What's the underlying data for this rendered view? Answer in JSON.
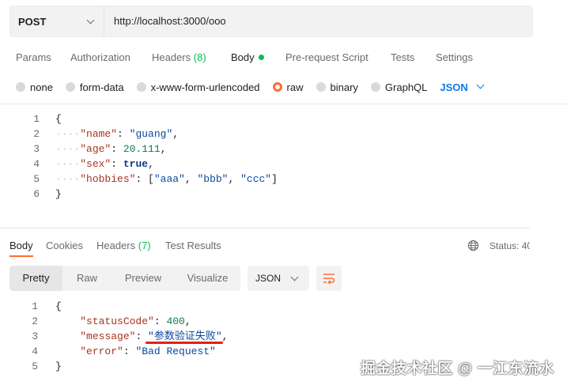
{
  "request": {
    "method": "POST",
    "url": "http://localhost:3000/ooo"
  },
  "request_tabs": [
    {
      "label": "Params"
    },
    {
      "label": "Authorization"
    },
    {
      "label": "Headers",
      "count": "(8)"
    },
    {
      "label": "Body"
    },
    {
      "label": "Pre-request Script"
    },
    {
      "label": "Tests"
    },
    {
      "label": "Settings"
    }
  ],
  "body_types": [
    "none",
    "form-data",
    "x-www-form-urlencoded",
    "raw",
    "binary",
    "GraphQL"
  ],
  "body_format": "JSON",
  "request_body": {
    "line_numbers": [
      "1",
      "2",
      "3",
      "4",
      "5",
      "6"
    ],
    "open": "{",
    "close": "}",
    "name_key": "\"name\"",
    "name_val": "\"guang\"",
    "age_key": "\"age\"",
    "age_val": "20.111",
    "sex_key": "\"sex\"",
    "sex_val": "true",
    "hobbies_key": "\"hobbies\"",
    "hobby1": "\"aaa\"",
    "hobby2": "\"bbb\"",
    "hobby3": "\"ccc\""
  },
  "response_tabs": [
    {
      "label": "Body"
    },
    {
      "label": "Cookies"
    },
    {
      "label": "Headers",
      "count": "(7)"
    },
    {
      "label": "Test Results"
    }
  ],
  "status_label": "Status: 40",
  "view_modes": [
    "Pretty",
    "Raw",
    "Preview",
    "Visualize"
  ],
  "response_format": "JSON",
  "response_body": {
    "line_numbers": [
      "1",
      "2",
      "3",
      "4",
      "5"
    ],
    "open": "{",
    "close": "}",
    "status_key": "\"statusCode\"",
    "status_val": "400",
    "message_key": "\"message\"",
    "message_val": "\"参数验证失败\"",
    "error_key": "\"error\"",
    "error_val": "\"Bad Request\""
  },
  "watermark": "掘金技术社区 @ 一江东流水",
  "colors": {
    "accent": "#ff6c37",
    "green": "#0cbb52",
    "link_blue": "#097bed",
    "underline_red": "#e3201a"
  }
}
